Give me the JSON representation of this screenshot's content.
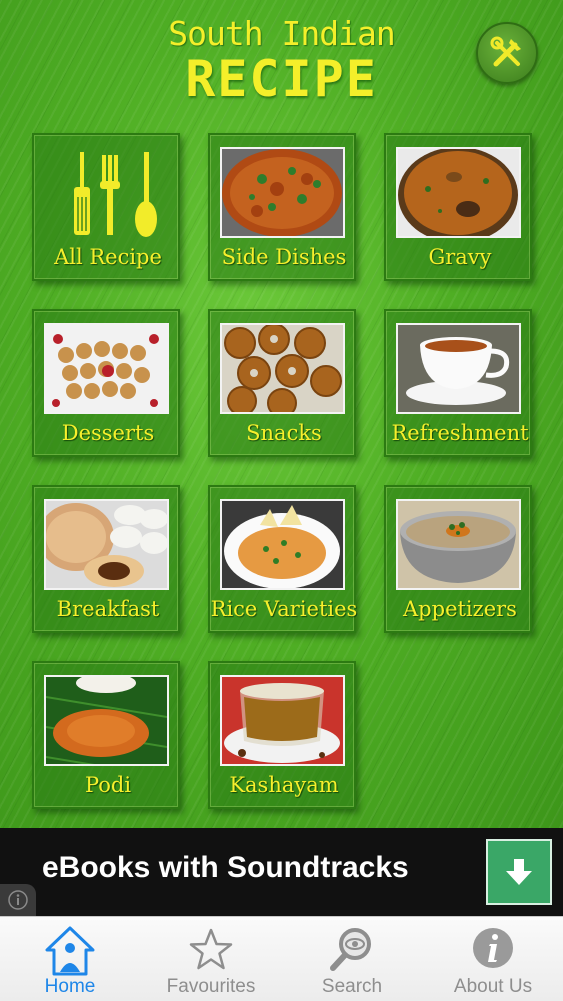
{
  "header": {
    "title_line1": "South Indian",
    "title_line2": "RECIPE",
    "settings_icon": "tools-icon",
    "title_color": "#f4ef2a"
  },
  "categories": [
    {
      "label": "All Recipe",
      "icon": "utensils-icon"
    },
    {
      "label": "Side Dishes",
      "icon": "side-dish-image"
    },
    {
      "label": "Gravy",
      "icon": "gravy-image"
    },
    {
      "label": "Desserts",
      "icon": "desserts-image"
    },
    {
      "label": "Snacks",
      "icon": "snacks-image"
    },
    {
      "label": "Refreshment",
      "icon": "tea-cup-image"
    },
    {
      "label": "Breakfast",
      "icon": "breakfast-image"
    },
    {
      "label": "Rice Varieties",
      "icon": "rice-image"
    },
    {
      "label": "Appetizers",
      "icon": "soup-image"
    },
    {
      "label": "Podi",
      "icon": "podi-image"
    },
    {
      "label": "Kashayam",
      "icon": "kashayam-image"
    }
  ],
  "ad_banner": {
    "text": "eBooks with Soundtracks",
    "button_icon": "download-arrow-icon",
    "button_color": "#3aa767"
  },
  "tabbar": {
    "active_color": "#1e86e8",
    "tabs": [
      {
        "label": "Home",
        "icon": "home-icon",
        "active": true
      },
      {
        "label": "Favourites",
        "icon": "star-icon",
        "active": false
      },
      {
        "label": "Search",
        "icon": "magnifier-icon",
        "active": false
      },
      {
        "label": "About Us",
        "icon": "info-icon",
        "active": false
      }
    ]
  }
}
